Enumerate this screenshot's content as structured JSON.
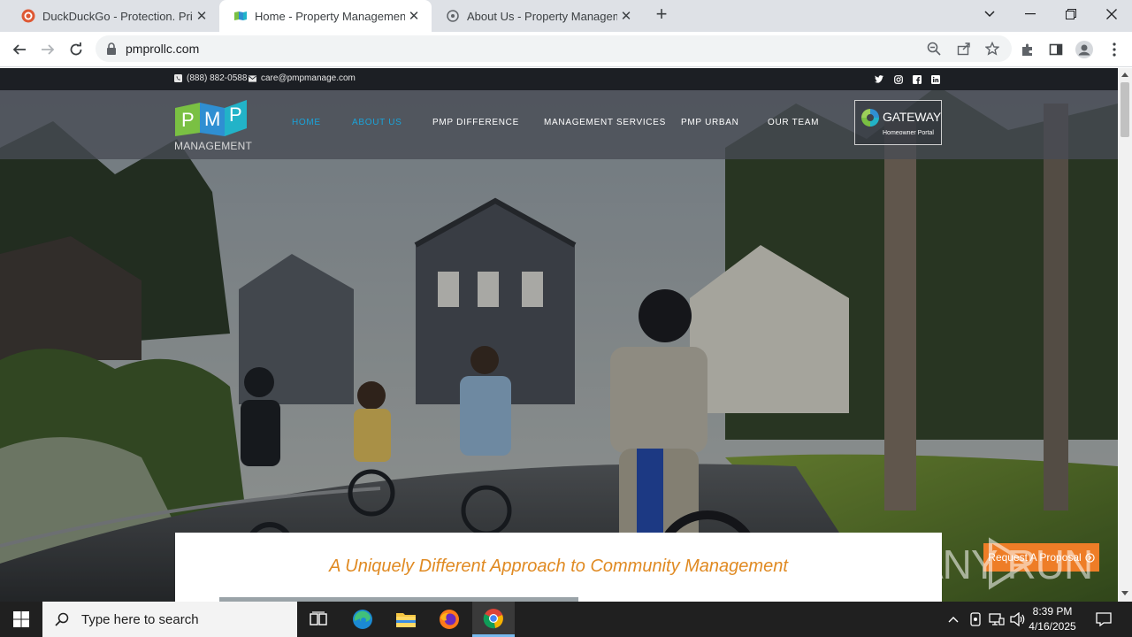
{
  "browser": {
    "tabs": [
      {
        "title": "DuckDuckGo - Protection. Privac",
        "active": false
      },
      {
        "title": "Home - Property Management I",
        "active": true
      },
      {
        "title": "About Us - Property Manageme",
        "active": false
      }
    ],
    "new_tab_icon": "plus-icon",
    "url": "pmprollc.com"
  },
  "site": {
    "topbar": {
      "phone": "(888) 882-0588",
      "email": "care@pmpmanage.com",
      "social": [
        "twitter-icon",
        "instagram-icon",
        "facebook-icon",
        "linkedin-icon"
      ]
    },
    "logo": {
      "letters": [
        "P",
        "M",
        "P"
      ],
      "label": "MANAGEMENT"
    },
    "menu": [
      {
        "label": "HOME",
        "highlight": true
      },
      {
        "label": "ABOUT US",
        "highlight": true
      },
      {
        "label": "PMP DIFFERENCE",
        "highlight": false
      },
      {
        "label": "MANAGEMENT SERVICES",
        "highlight": false
      },
      {
        "label": "PMP URBAN",
        "highlight": false
      },
      {
        "label": "OUR TEAM",
        "highlight": false
      }
    ],
    "gateway": {
      "title": "GATEWAY",
      "subtitle": "Homeowner Portal"
    },
    "tagline": "A Uniquely Different Approach to Community Management",
    "request_button": "Request A Proposal",
    "watermark": "ANY RUN",
    "colors": {
      "accent_blue": "#1aa3d9",
      "orange": "#e08a22",
      "button_orange": "#ee7d27"
    }
  },
  "taskbar": {
    "search_placeholder": "Type here to search",
    "time": "8:39 PM",
    "date": "4/16/2025"
  }
}
